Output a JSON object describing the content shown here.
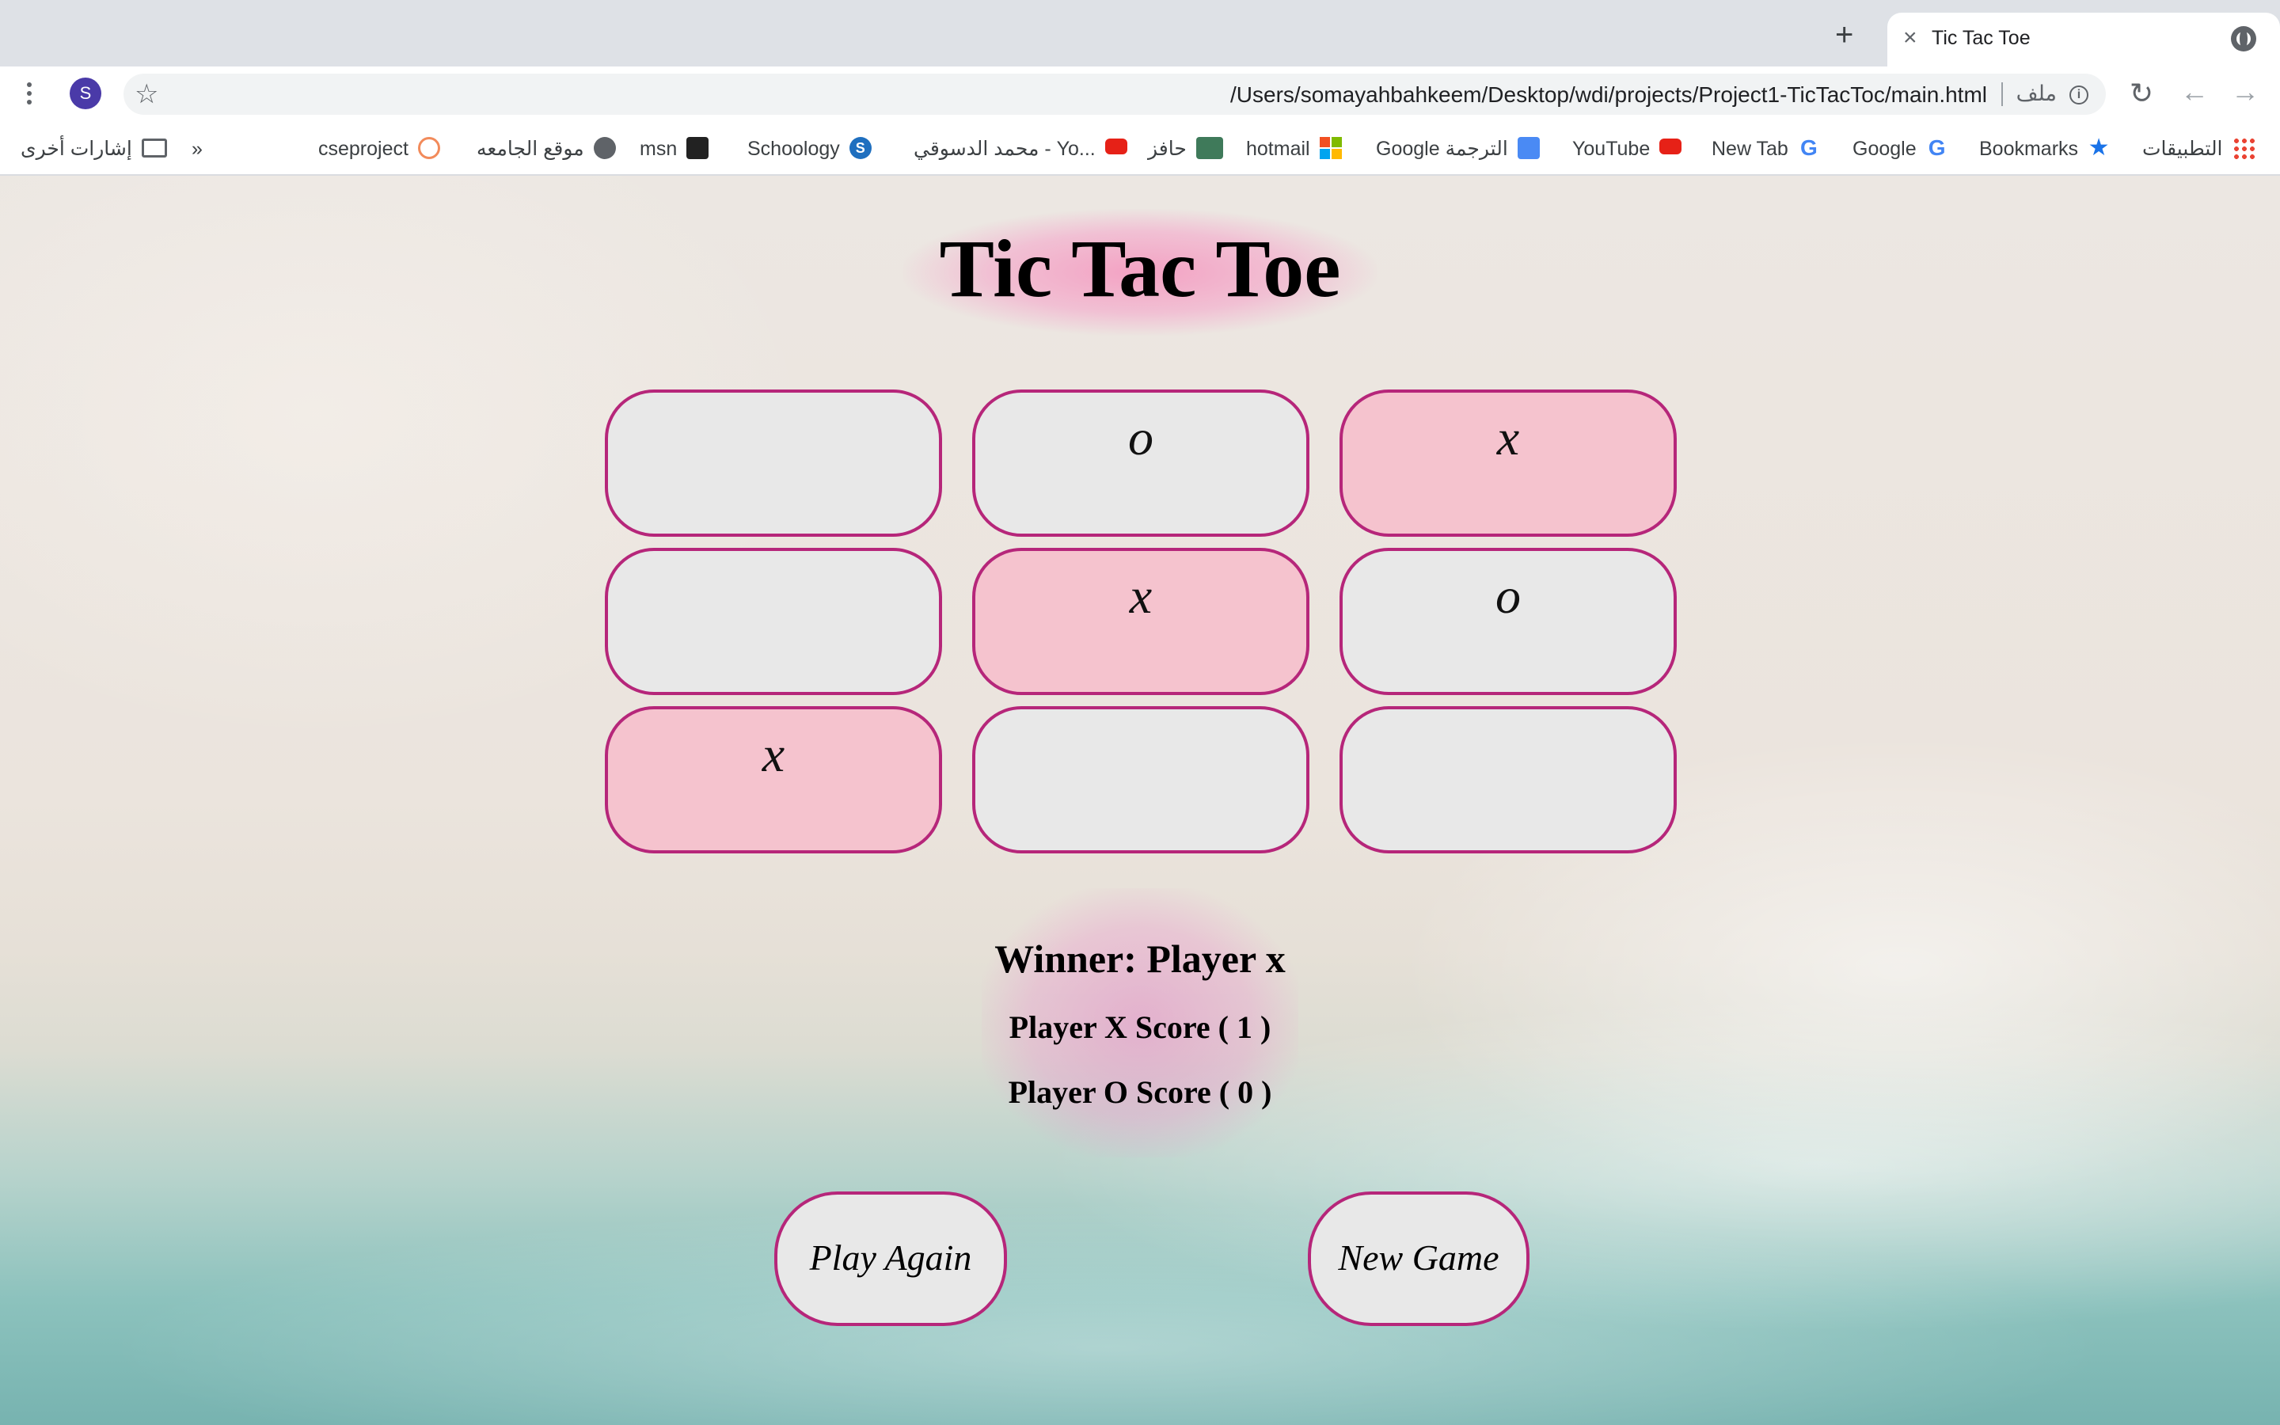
{
  "browser": {
    "tab_title": "Tic Tac Toe",
    "avatar_letter": "S",
    "url": "/Users/somayahbahkeem/Desktop/wdi/projects/Project1-TicTacToc/main.html",
    "file_label": "ملف",
    "bookmarks": [
      {
        "label": "التطبيقات",
        "icon": "apps-grid-icon"
      },
      {
        "label": "Bookmarks",
        "icon": "star-icon"
      },
      {
        "label": "Google",
        "icon": "google-icon"
      },
      {
        "label": "New Tab",
        "icon": "google-icon"
      },
      {
        "label": "YouTube",
        "icon": "youtube-icon"
      },
      {
        "label": "Google الترجمة",
        "icon": "translate-icon"
      },
      {
        "label": "hotmail",
        "icon": "microsoft-icon"
      },
      {
        "label": "حافز",
        "icon": "hafiz-icon"
      },
      {
        "label": "محمد الدسوقي - Yo...",
        "icon": "youtube-icon"
      },
      {
        "label": "Schoology",
        "icon": "schoology-icon"
      },
      {
        "label": "msn",
        "icon": "msn-icon"
      },
      {
        "label": "موقع الجامعه",
        "icon": "globe-icon"
      },
      {
        "label": "cseproject",
        "icon": "cseproject-icon"
      }
    ],
    "overflow": "»",
    "other_bookmarks": "إشارات أخرى"
  },
  "game": {
    "title": "Tic Tac Toe",
    "cells": [
      "",
      "o",
      "x",
      "",
      "x",
      "o",
      "x",
      "",
      ""
    ],
    "winner": "Winner: Player x",
    "score_x": "Player X Score ( 1 )",
    "score_o": "Player O Score ( 0 )",
    "play_again": "Play Again",
    "new_game": "New Game"
  },
  "colors": {
    "cell_border": "#b6267a",
    "cell_default": "#e8e8e8",
    "cell_x": "#f5c3ce",
    "glow": "#f596be"
  }
}
